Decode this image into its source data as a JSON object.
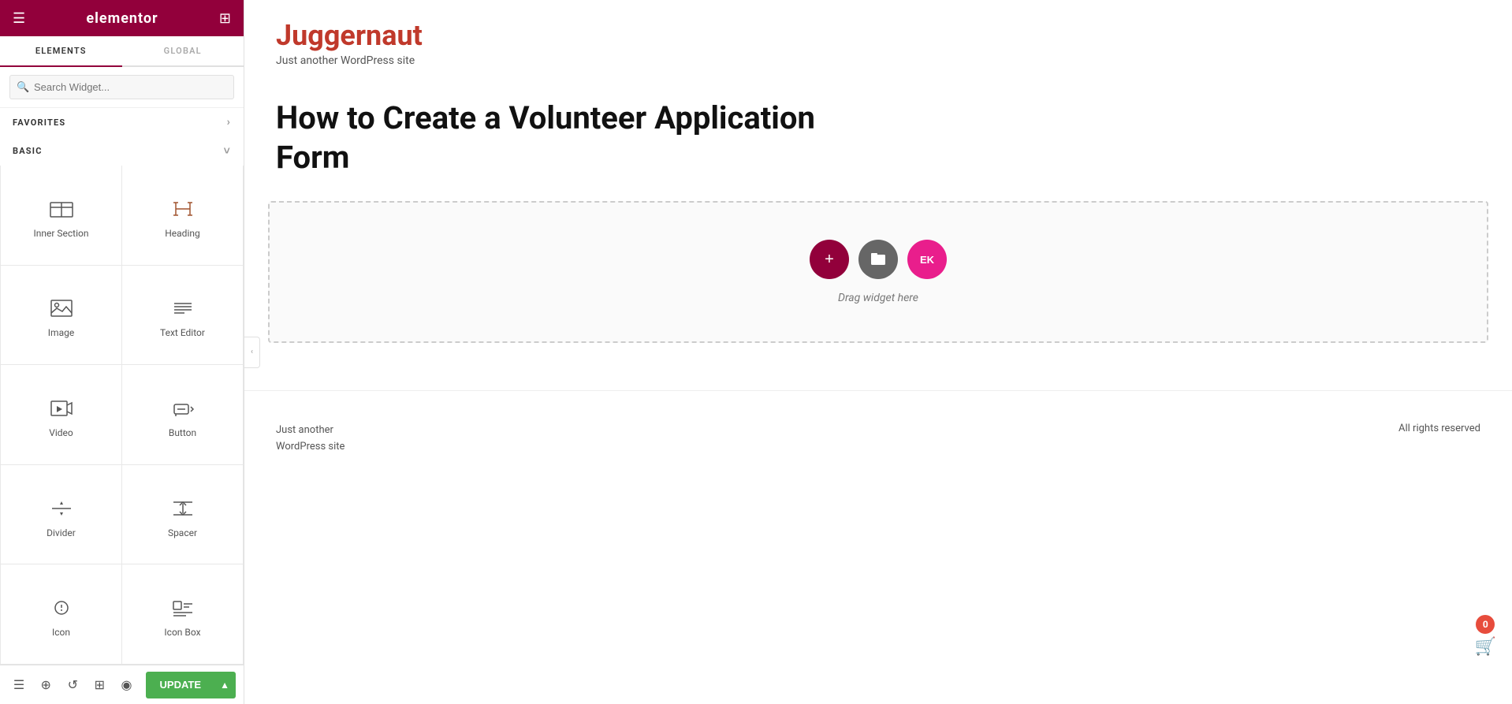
{
  "header": {
    "logo": "elementor",
    "hamburger_label": "☰",
    "grid_label": "⊞"
  },
  "tabs": [
    {
      "id": "elements",
      "label": "ELEMENTS",
      "active": true
    },
    {
      "id": "global",
      "label": "GLOBAL",
      "active": false
    }
  ],
  "search": {
    "placeholder": "Search Widget..."
  },
  "sections": {
    "favorites": {
      "label": "FAVORITES",
      "chevron": "›"
    },
    "basic": {
      "label": "BASIC",
      "chevron": "˅"
    }
  },
  "widgets": [
    {
      "id": "inner-section",
      "label": "Inner Section",
      "icon_type": "inner-section"
    },
    {
      "id": "heading",
      "label": "Heading",
      "icon_type": "heading"
    },
    {
      "id": "image",
      "label": "Image",
      "icon_type": "image"
    },
    {
      "id": "text-editor",
      "label": "Text Editor",
      "icon_type": "text-editor"
    },
    {
      "id": "video",
      "label": "Video",
      "icon_type": "video"
    },
    {
      "id": "button",
      "label": "Button",
      "icon_type": "button"
    },
    {
      "id": "divider",
      "label": "Divider",
      "icon_type": "divider"
    },
    {
      "id": "spacer",
      "label": "Spacer",
      "icon_type": "spacer"
    },
    {
      "id": "icon",
      "label": "Icon",
      "icon_type": "icon-widget"
    },
    {
      "id": "icon-box",
      "label": "Icon Box",
      "icon_type": "icon-box"
    }
  ],
  "toolbar": {
    "update_label": "UPDATE"
  },
  "canvas": {
    "site_title": "Juggernaut",
    "site_tagline": "Just another WordPress site",
    "post_title": "How to Create a Volunteer Application Form",
    "drag_text": "Drag widget here",
    "footer_left_line1": "Just another",
    "footer_left_line2": "WordPress site",
    "footer_right": "All rights reserved",
    "cart_count": "0"
  },
  "drop_buttons": [
    {
      "id": "add",
      "symbol": "+",
      "color": "#92003b"
    },
    {
      "id": "folder",
      "symbol": "■",
      "color": "#666"
    },
    {
      "id": "ek",
      "symbol": "EK",
      "color": "#e91e8c"
    }
  ],
  "colors": {
    "brand": "#92003b",
    "green": "#4caf50",
    "text_dark": "#111",
    "text_muted": "#777"
  }
}
